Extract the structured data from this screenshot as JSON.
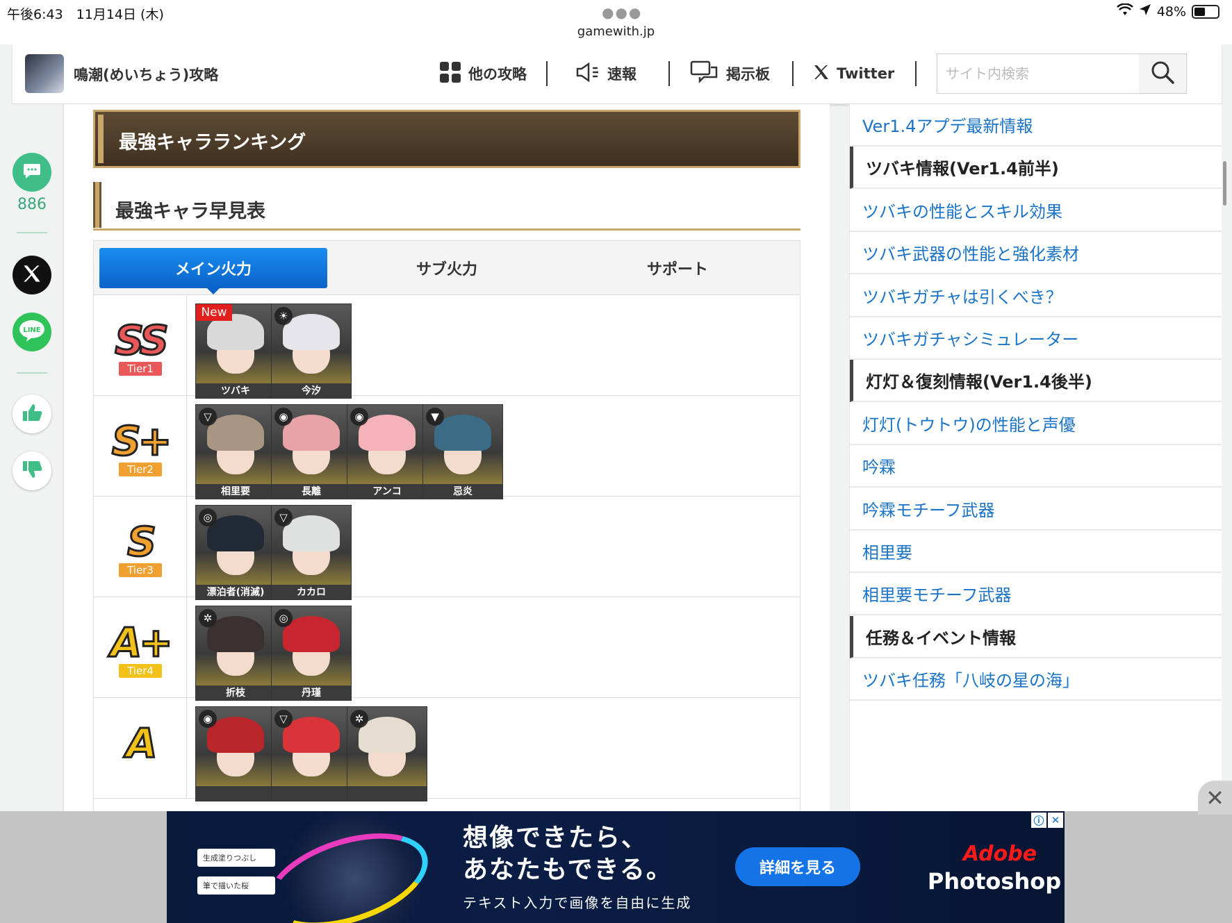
{
  "status_bar": {
    "time_date": "午後6:43　11月14日 (木)",
    "url": "gamewith.jp",
    "battery": "48%",
    "battery_level": 0.48
  },
  "header": {
    "site_title": "鳴潮(めいちょう)攻略",
    "nav": [
      {
        "label": "他の攻略",
        "icon": "grid-icon"
      },
      {
        "label": "速報",
        "icon": "megaphone-icon"
      },
      {
        "label": "掲示板",
        "icon": "chat-bubbles-icon"
      },
      {
        "label": "Twitter",
        "icon": "x-logo-icon"
      }
    ],
    "search_placeholder": "サイト内検索"
  },
  "share_rail": {
    "comment_count": "886"
  },
  "main": {
    "banner_title": "最強キャラランキング",
    "section_title": "最強キャラ早見表",
    "tabs": [
      "メイン火力",
      "サブ火力",
      "サポート"
    ],
    "active_tab": 0,
    "tiers": [
      {
        "rank": "SS",
        "badge": "Tier1",
        "color": "#e85858",
        "chars": [
          {
            "name": "ツバキ",
            "new": true,
            "new_label": "New",
            "element": "",
            "hair": "#d9d9d9"
          },
          {
            "name": "今汐",
            "new": false,
            "element": "☀",
            "hair": "#e6e6ea"
          }
        ]
      },
      {
        "rank": "S+",
        "badge": "Tier2",
        "color": "#f0a030",
        "chars": [
          {
            "name": "相里要",
            "element": "▽",
            "hair": "#a89683"
          },
          {
            "name": "長離",
            "element": "◉",
            "hair": "#e8a3a6"
          },
          {
            "name": "アンコ",
            "element": "◉",
            "hair": "#f3b3b8"
          },
          {
            "name": "忌炎",
            "element": "▼",
            "hair": "#3c6b86"
          }
        ]
      },
      {
        "rank": "S",
        "badge": "Tier3",
        "color": "#f0a030",
        "chars": [
          {
            "name": "漂泊者(消滅)",
            "element": "◎",
            "hair": "#222a36"
          },
          {
            "name": "カカロ",
            "element": "▽",
            "hair": "#dfe0e0"
          }
        ]
      },
      {
        "rank": "A+",
        "badge": "Tier4",
        "color": "#f3c21a",
        "chars": [
          {
            "name": "折枝",
            "element": "✲",
            "hair": "#3a3030"
          },
          {
            "name": "丹瑾",
            "element": "◎",
            "hair": "#c8262f"
          }
        ]
      },
      {
        "rank": "A",
        "badge": "",
        "color": "#f3c21a",
        "chars": [
          {
            "name": "",
            "element": "◉",
            "hair": "#b8262a"
          },
          {
            "name": "",
            "element": "▽",
            "hair": "#d8343a"
          },
          {
            "name": "",
            "element": "✲",
            "hair": "#e6ddd0"
          }
        ]
      }
    ]
  },
  "sidebar": {
    "items": [
      {
        "label": "Ver1.4アプデ最新情報",
        "type": "link"
      },
      {
        "label": "ツバキ情報(Ver1.4前半)",
        "type": "category"
      },
      {
        "label": "ツバキの性能とスキル効果",
        "type": "link"
      },
      {
        "label": "ツバキ武器の性能と強化素材",
        "type": "link"
      },
      {
        "label": "ツバキガチャは引くべき？",
        "type": "link"
      },
      {
        "label": "ツバキガチャシミュレーター",
        "type": "link"
      },
      {
        "label": "灯灯＆復刻情報(Ver1.4後半)",
        "type": "category"
      },
      {
        "label": "灯灯(トウトウ)の性能と声優",
        "type": "link"
      },
      {
        "label": "吟霖",
        "type": "link"
      },
      {
        "label": "吟霖モチーフ武器",
        "type": "link"
      },
      {
        "label": "相里要",
        "type": "link"
      },
      {
        "label": "相里要モチーフ武器",
        "type": "link"
      },
      {
        "label": "任務＆イベント情報",
        "type": "category"
      },
      {
        "label": "ツバキ任務「八岐の星の海」",
        "type": "link"
      }
    ]
  },
  "ad": {
    "headline_1": "想像できたら、",
    "headline_2": "あなたもできる。",
    "sub": "テキスト入力で画像を自由に生成",
    "cta": "詳細を見る",
    "brand_1": "Adobe",
    "brand_2": "Photoshop",
    "chip_1": "生成塗りつぶし",
    "chip_2": "筆で描いた桜"
  }
}
